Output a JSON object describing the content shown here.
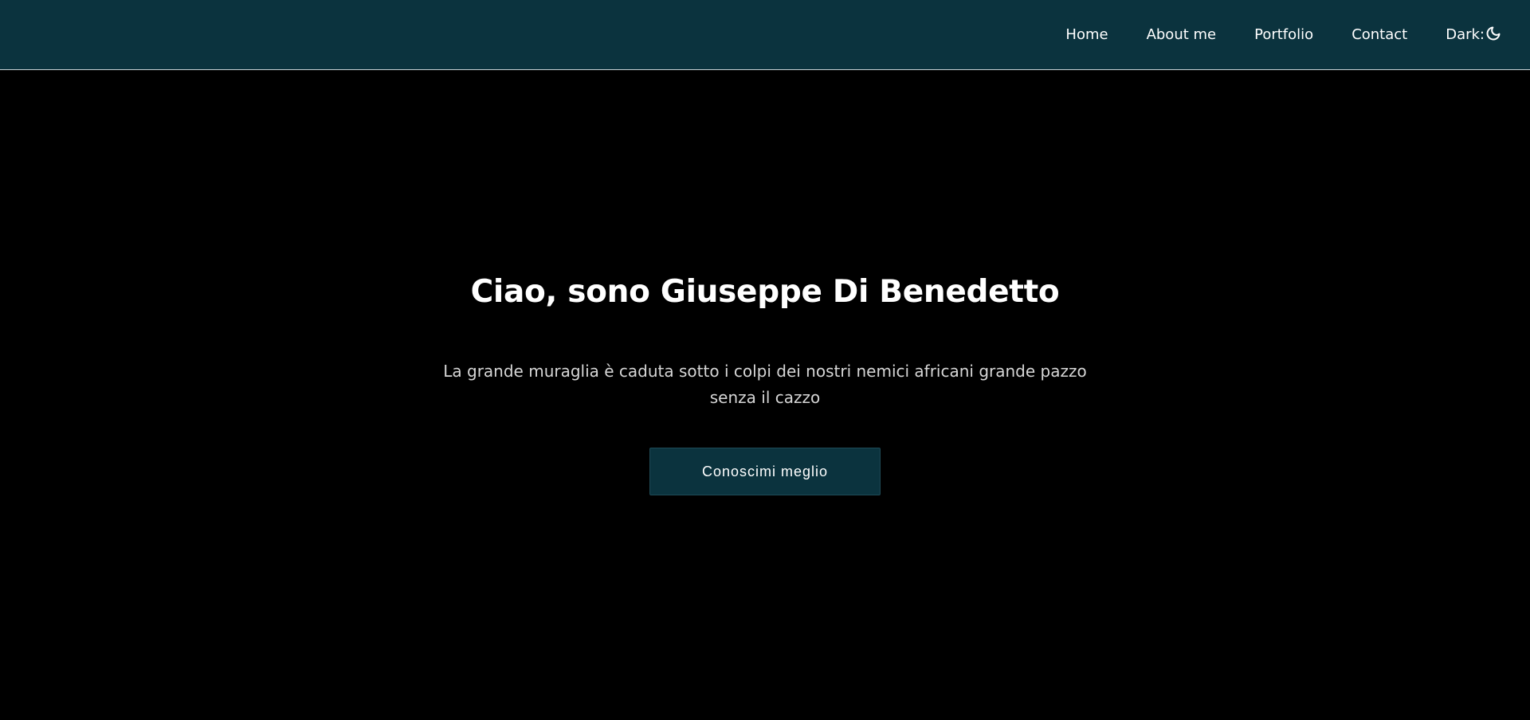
{
  "nav": {
    "items": [
      {
        "label": "Home"
      },
      {
        "label": "About me"
      },
      {
        "label": "Portfolio"
      },
      {
        "label": "Contact"
      }
    ],
    "dark_toggle_label": "Dark:",
    "dark_toggle_icon": "moon-icon"
  },
  "hero": {
    "title": "Ciao, sono Giuseppe Di Benedetto",
    "subtitle": "La grande muraglia è caduta sotto i colpi dei nostri nemici africani grande pazzo senza il cazzo",
    "button_label": "Conoscimi meglio"
  },
  "colors": {
    "navbar_bg": "#0b333e",
    "page_bg": "#000000",
    "button_bg": "#0b333e",
    "text": "#ffffff",
    "subtitle_text": "#d6d6d6"
  }
}
